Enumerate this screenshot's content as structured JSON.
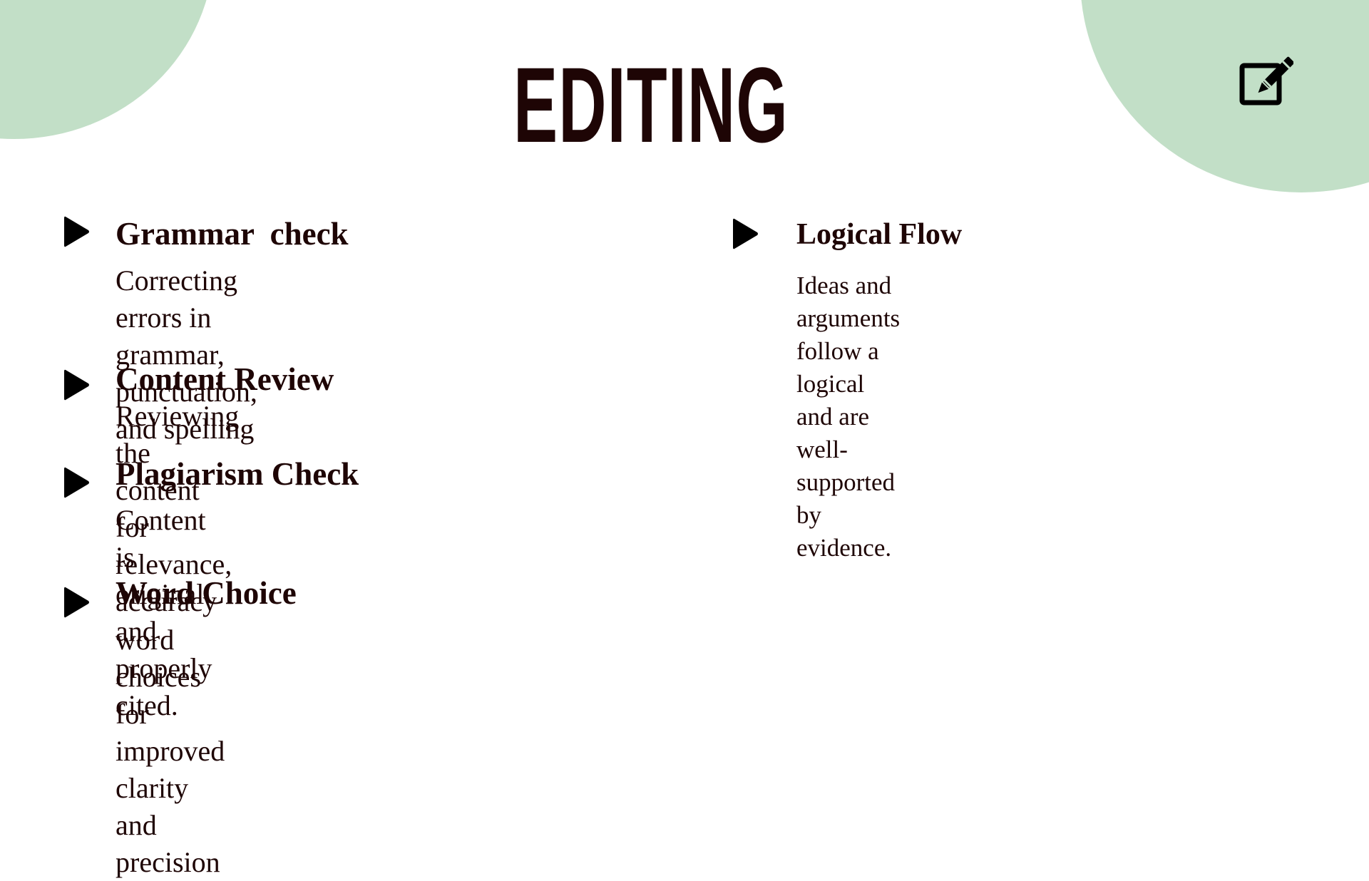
{
  "slide": {
    "title": "EDITING",
    "icon": "edit-square-icon",
    "colors": {
      "accent_green": "#c2dfc7",
      "text": "#1e0505",
      "background": "#ffffff"
    },
    "left_column": [
      {
        "heading": "Grammar  check",
        "description": "Correcting errors in grammar, punctuation,\nand spelling"
      },
      {
        "heading": "Content Review",
        "description": "Reviewing the content for relevance, accuracy"
      },
      {
        "heading": "Plagiarism Check",
        "description": "Content is original and properly cited."
      },
      {
        "heading": "Word Choice",
        "description": "word choices for improved clarity and\nprecision"
      }
    ],
    "right_column": [
      {
        "heading": "Logical Flow",
        "description": "Ideas and arguments follow a logical  and are\nwell-supported by evidence."
      }
    ]
  }
}
